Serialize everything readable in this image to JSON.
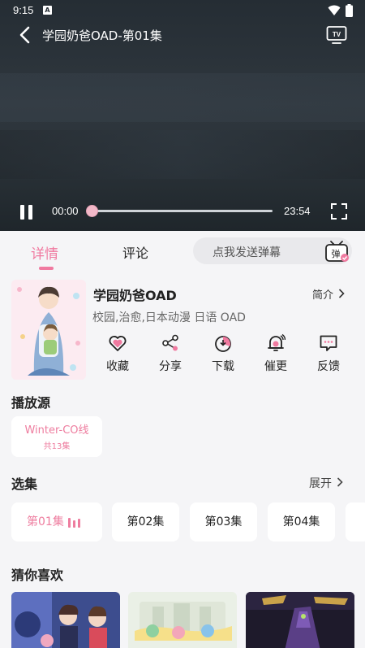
{
  "status_bar": {
    "time": "9:15",
    "notification_icon": "A"
  },
  "player": {
    "title": "学园奶爸OAD-第01集",
    "current_time": "00:00",
    "total_time": "23:54",
    "progress": 0.0,
    "icons": [
      "back-icon",
      "tv-cast-icon",
      "pause-icon",
      "fullscreen-icon"
    ]
  },
  "tabs": {
    "detail": "详情",
    "comment": "评论"
  },
  "danmaku": {
    "placeholder": "点我发送弹幕",
    "icon_label": "弹"
  },
  "show": {
    "title": "学园奶爸OAD",
    "intro_label": "简介",
    "tags": "校园,治愈,日本动漫 日语 OAD"
  },
  "actions": [
    {
      "label": "收藏",
      "icon": "heart-icon"
    },
    {
      "label": "分享",
      "icon": "share-icon"
    },
    {
      "label": "下载",
      "icon": "download-icon"
    },
    {
      "label": "催更",
      "icon": "bell-icon"
    },
    {
      "label": "反馈",
      "icon": "feedback-icon"
    }
  ],
  "source": {
    "section_title": "播放源",
    "name": "Winter-CO线",
    "count": "共13集"
  },
  "episodes": {
    "section_title": "选集",
    "expand_label": "展开",
    "items": [
      "第01集",
      "第02集",
      "第03集",
      "第04集"
    ]
  },
  "recommend": {
    "section_title": "猜你喜欢"
  },
  "colors": {
    "accent": "#ee7d9f",
    "panel_bg": "#f5f5f7"
  }
}
